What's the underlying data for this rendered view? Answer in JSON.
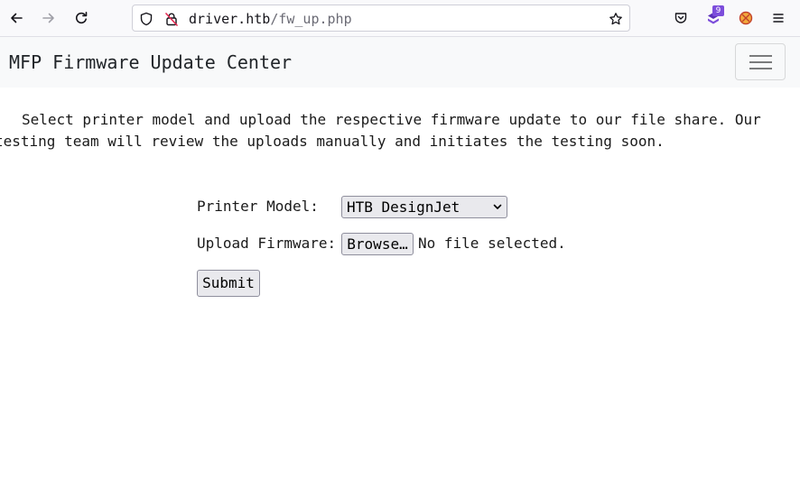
{
  "browser": {
    "url_host": "driver.htb",
    "url_path": "/fw_up.php",
    "extension_badge": "9",
    "icons": {
      "back": "arrow-left-icon",
      "forward": "arrow-right-icon",
      "reload": "reload-icon",
      "tracking": "shield-icon",
      "insecure": "lock-insecure-icon",
      "bookmark": "star-icon",
      "pocket": "pocket-icon",
      "extension": "extension-icon",
      "addon": "addon-icon",
      "menu": "hamburger-menu-icon"
    }
  },
  "navbar": {
    "brand": "MFP Firmware Update Center",
    "toggler_icon": "hamburger-icon"
  },
  "main": {
    "intro": "Select printer model and upload the respective firmware update to our file share. Our testing team will review the uploads manually and initiates the testing soon.",
    "printer_model_label": "Printer Model:",
    "printer_model_selected": "HTB DesignJet",
    "upload_label": "Upload Firmware:",
    "browse_label": "Browse…",
    "no_file_text": "No file selected.",
    "submit_label": "Submit"
  },
  "colors": {
    "navbar_bg": "#f8f9fa",
    "toolbar_bg": "#f9f9fb",
    "button_bg": "#e9e9ed",
    "badge": "#7c4ddb"
  }
}
